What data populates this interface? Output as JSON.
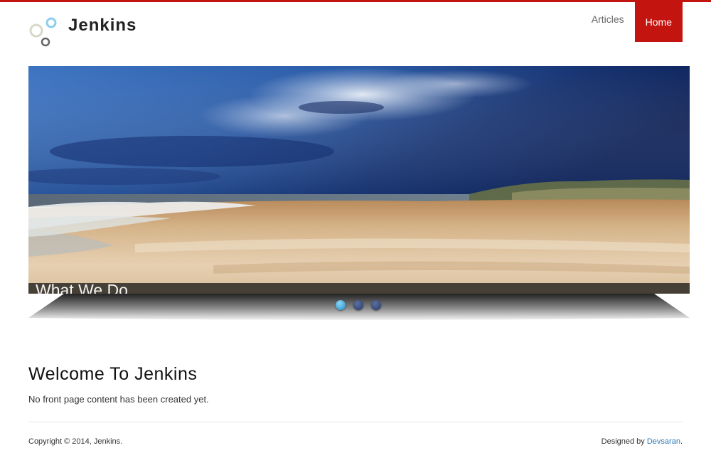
{
  "header": {
    "site_name": "Jenkins",
    "logo": "bubbles-logo"
  },
  "nav": {
    "items": [
      {
        "label": "Articles",
        "active": false
      },
      {
        "label": "Home",
        "active": true
      }
    ]
  },
  "slider": {
    "caption": "What We Do",
    "image": "beach-landscape",
    "dots": [
      {
        "active": true
      },
      {
        "active": false
      },
      {
        "active": false
      }
    ]
  },
  "content": {
    "title": "Welcome To Jenkins",
    "text": "No front page content has been created yet."
  },
  "footer": {
    "copyright": "Copyright © 2014, Jenkins.",
    "designed_by_prefix": "Designed by ",
    "designer_name": "Devsaran",
    "suffix": "."
  },
  "colors": {
    "accent": "#c4140f",
    "link": "#2a7ab8"
  }
}
